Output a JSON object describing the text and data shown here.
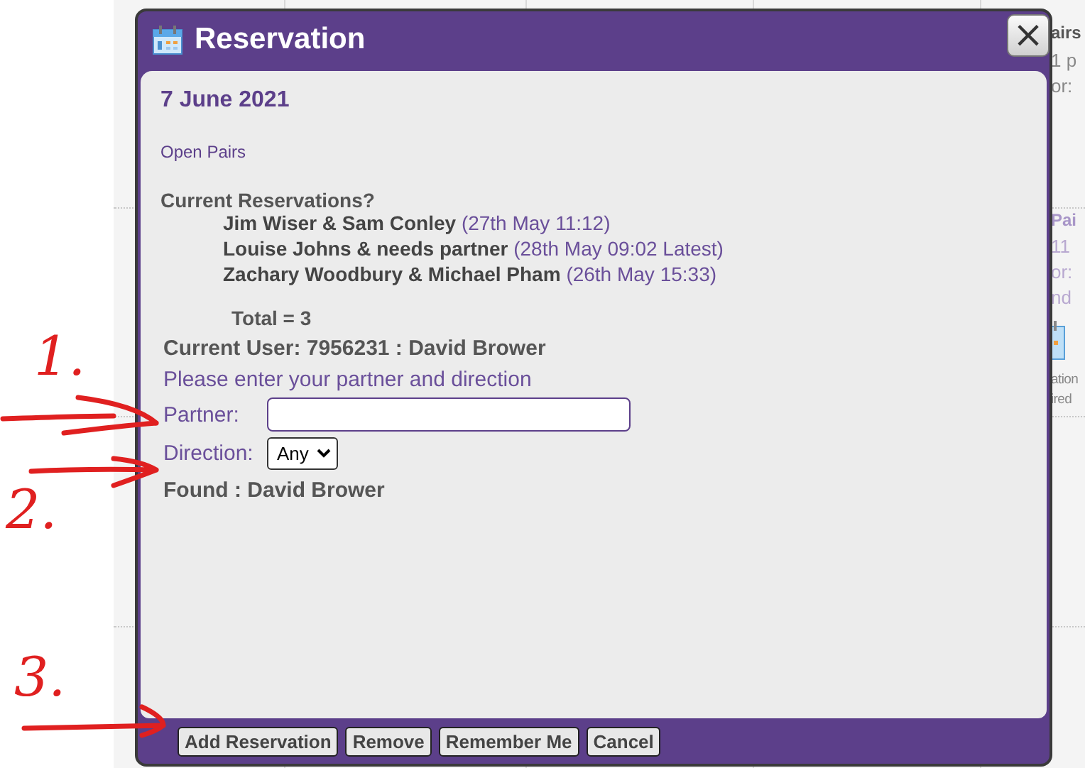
{
  "background": {
    "fragments": [
      {
        "text": "airs",
        "kind": "title"
      },
      {
        "text": "1 p",
        "kind": "plain"
      },
      {
        "text": "or:",
        "kind": "plain"
      },
      {
        "text": "Pai",
        "kind": "title-faded"
      },
      {
        "text": "11",
        "kind": "faded"
      },
      {
        "text": "or:",
        "kind": "faded"
      },
      {
        "text": "nd",
        "kind": "faded"
      },
      {
        "text": "ation",
        "kind": "small"
      },
      {
        "text": "ired",
        "kind": "small"
      }
    ]
  },
  "dialog": {
    "title": "Reservation",
    "close": "×",
    "date": "7 June 2021",
    "event": "Open Pairs",
    "reservations_heading": "Current Reservations?",
    "reservations": [
      {
        "names": "Jim Wiser & Sam Conley",
        "detail": "(27th May 11:12)"
      },
      {
        "names": "Louise Johns & needs partner",
        "detail": "(28th May 09:02 Latest)"
      },
      {
        "names": "Zachary Woodbury & Michael Pham",
        "detail": "(26th May 15:33)"
      }
    ],
    "total": "Total = 3",
    "current_user": "Current User: 7956231 : David Brower",
    "prompt": "Please enter your partner and direction",
    "partner_label": "Partner:",
    "direction_label": "Direction:",
    "direction_value": "Any",
    "found": "Found : David Brower",
    "buttons": [
      "Add Reservation",
      "Remove",
      "Remember Me",
      "Cancel"
    ]
  },
  "annotations": [
    {
      "label": "1."
    },
    {
      "label": "2."
    },
    {
      "label": "3."
    }
  ]
}
